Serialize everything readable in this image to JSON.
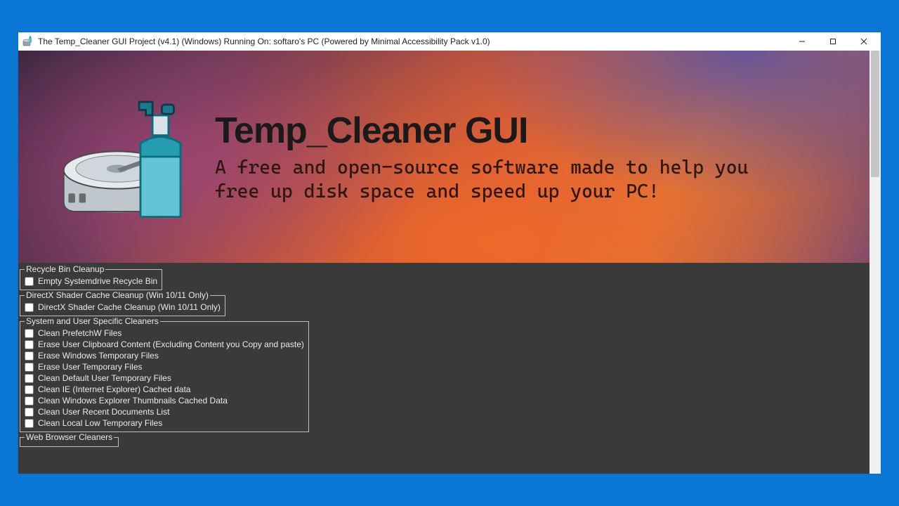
{
  "window": {
    "title": "The Temp_Cleaner GUI Project (v4.1) (Windows) Running On: softaro's PC (Powered by Minimal Accessibility Pack v1.0)"
  },
  "banner": {
    "title": "Temp_Cleaner GUI",
    "subtitle": "A free and open-source software made to help you free up disk space and speed up your PC!"
  },
  "groups": [
    {
      "id": "recycle-bin",
      "legend": "Recycle Bin Cleanup",
      "items": [
        {
          "label": "Empty Systemdrive Recycle Bin"
        }
      ]
    },
    {
      "id": "directx",
      "legend": "DirectX Shader Cache Cleanup (Win 10/11 Only)",
      "items": [
        {
          "label": "DirectX Shader Cache Cleanup (Win 10/11 Only)"
        }
      ]
    },
    {
      "id": "system-user",
      "legend": "System and User Specific Cleaners",
      "items": [
        {
          "label": "Clean PrefetchW Files"
        },
        {
          "label": "Erase User Clipboard Content (Excluding Content you Copy and paste)"
        },
        {
          "label": "Erase Windows Temporary Files"
        },
        {
          "label": "Erase User Temporary Files"
        },
        {
          "label": "Clean Default User Temporary Files"
        },
        {
          "label": "Clean IE (Internet Explorer) Cached data"
        },
        {
          "label": "Clean Windows Explorer Thumbnails Cached Data"
        },
        {
          "label": "Clean User Recent Documents List"
        },
        {
          "label": "Clean Local Low Temporary Files"
        }
      ]
    },
    {
      "id": "web-browser",
      "legend": "Web Browser Cleaners",
      "items": []
    }
  ]
}
